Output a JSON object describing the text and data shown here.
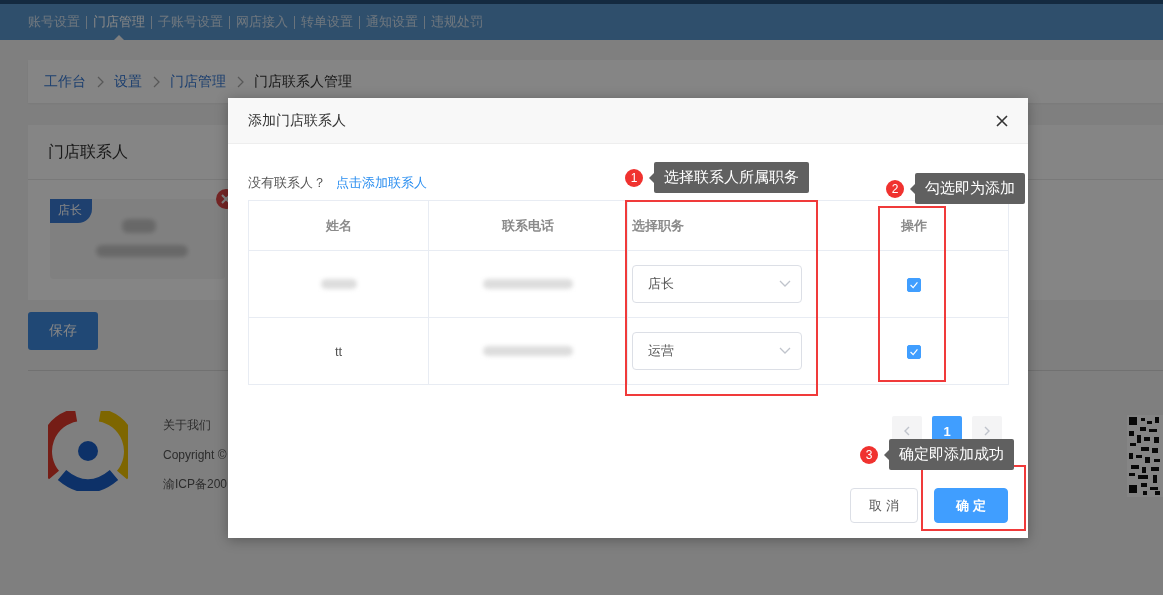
{
  "nav": {
    "items": [
      {
        "label": "账号设置",
        "selected": false
      },
      {
        "label": "门店管理",
        "selected": true
      },
      {
        "label": "子账号设置",
        "selected": false
      },
      {
        "label": "网店接入",
        "selected": false
      },
      {
        "label": "转单设置",
        "selected": false
      },
      {
        "label": "通知设置",
        "selected": false
      },
      {
        "label": "违规处罚",
        "selected": false
      }
    ]
  },
  "breadcrumb": [
    {
      "label": "工作台",
      "kind": "link"
    },
    {
      "label": "设置",
      "kind": "link"
    },
    {
      "label": "门店管理",
      "kind": "link"
    },
    {
      "label": "门店联系人管理",
      "kind": "current"
    }
  ],
  "contacts_card": {
    "title": "门店联系人",
    "contact": {
      "badge": "店长"
    }
  },
  "save_button": "保存",
  "footer": {
    "links": [
      "关于我们"
    ],
    "copyright": "Copyright ©",
    "icp": "渝ICP备200"
  },
  "modal": {
    "title": "添加门店联系人",
    "prompt": "没有联系人？",
    "add_link": "点击添加联系人",
    "table": {
      "columns": [
        "姓名",
        "联系电话",
        "选择职务",
        "操作"
      ],
      "rows": [
        {
          "role": "店长",
          "checked": true
        },
        {
          "name": "tt",
          "role": "运营",
          "checked": true
        }
      ]
    },
    "pagination": {
      "pages": [
        {
          "label": "1",
          "selected": true
        }
      ]
    },
    "buttons": [
      {
        "label": "取 消",
        "kind": "secondary"
      },
      {
        "label": "确 定",
        "kind": "primary"
      }
    ],
    "annotations": [
      {
        "number": "1",
        "text": "选择联系人所属职务"
      },
      {
        "number": "2",
        "text": "勾选即为添加"
      },
      {
        "number": "3",
        "text": "确定即添加成功"
      }
    ]
  }
}
